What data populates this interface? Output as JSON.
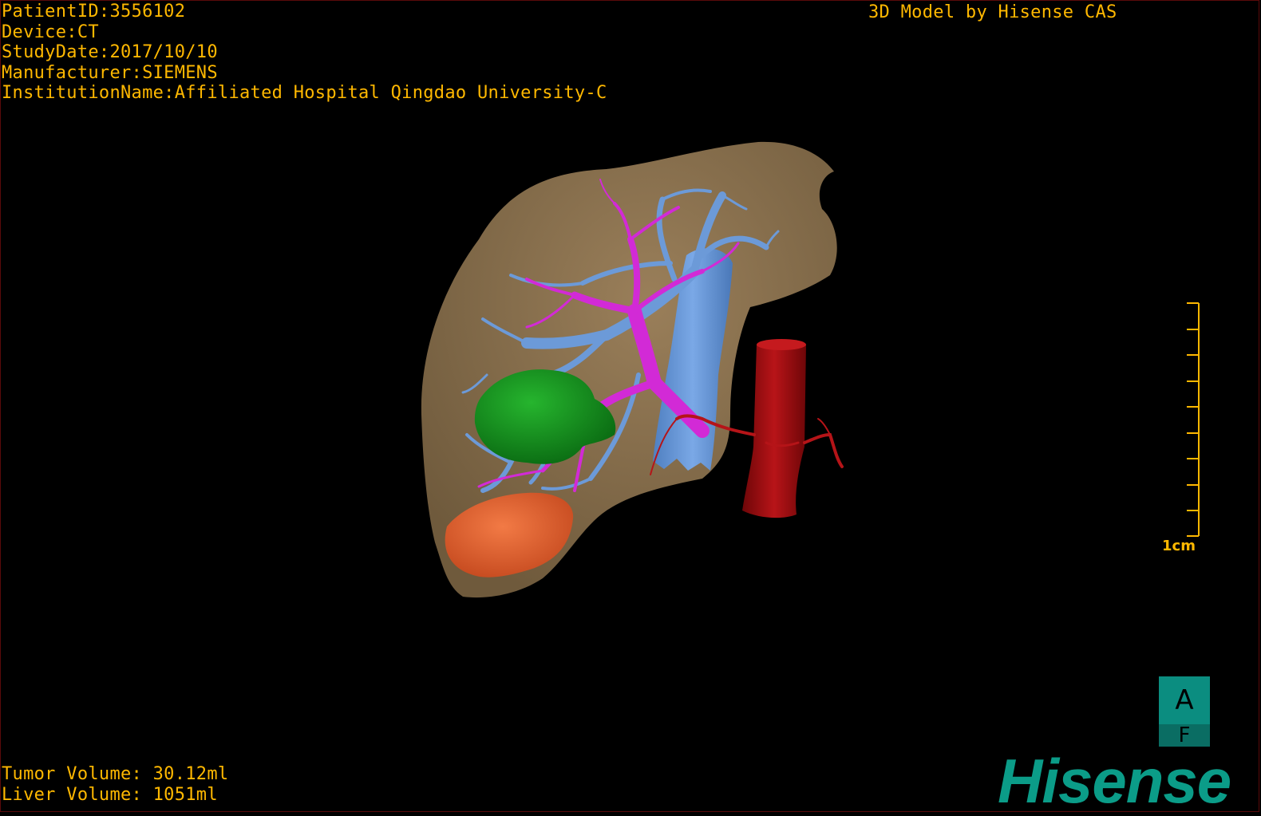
{
  "header": {
    "patient_id": "PatientID:3556102",
    "device": "Device:CT",
    "study_date": "StudyDate:2017/10/10",
    "manufacturer": "Manufacturer:SIEMENS",
    "institution": "InstitutionName:Affiliated Hospital Qingdao University-C",
    "credit": "3D Model by Hisense CAS"
  },
  "footer": {
    "tumor_volume": "Tumor Volume: 30.12ml",
    "liver_volume": "Liver Volume: 1051ml"
  },
  "scale_bar": {
    "label": "1cm"
  },
  "orientation_cube": {
    "top": "A",
    "bottom": "F"
  },
  "logo": {
    "text": "Hisense"
  },
  "colors": {
    "overlay_text": "#ffb800",
    "liver": "#8a7150",
    "hepatic_vein": "#6c9ad8",
    "portal_vein": "#d22ad6",
    "tumor": "#0f8a1a",
    "gallbladder": "#e05a2a",
    "aorta": "#a30f12",
    "logo": "#0b9c88"
  }
}
